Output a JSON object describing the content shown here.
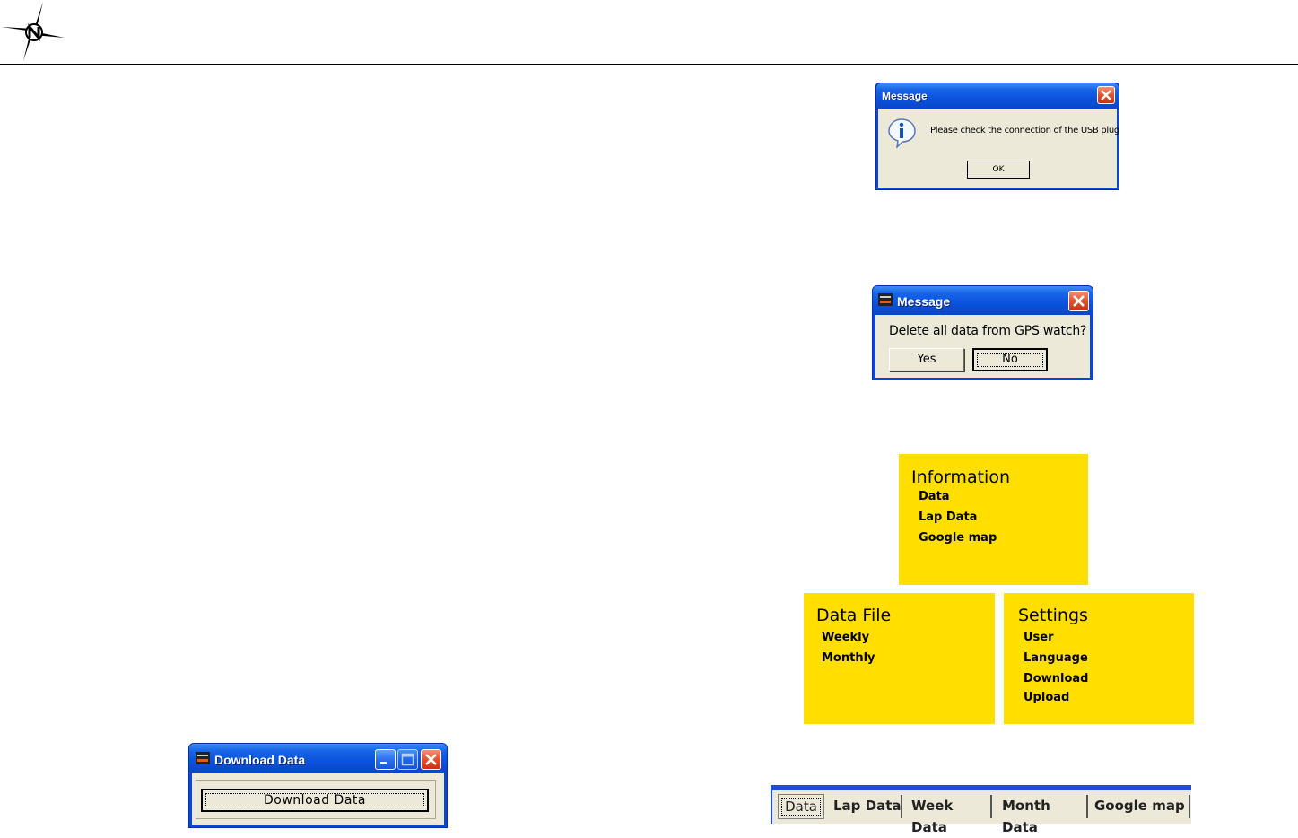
{
  "dialog_usb": {
    "title": "Message",
    "message": "Please check the connection of the USB plug",
    "ok_label": "OK"
  },
  "dialog_delete": {
    "title": "Message",
    "message": "Delete all data from GPS watch?",
    "yes_label": "Yes",
    "no_label": "No"
  },
  "menu_information": {
    "heading": "Information",
    "items": [
      "Data",
      "Lap Data",
      "Google map"
    ]
  },
  "menu_data_file": {
    "heading": "Data File",
    "items": [
      "Weekly",
      "Monthly"
    ]
  },
  "menu_settings": {
    "heading": "Settings",
    "items": [
      "User",
      "Language",
      "Download",
      "Upload"
    ]
  },
  "download_window": {
    "title": "Download Data",
    "button_label": "Download Data"
  },
  "tabs": [
    "Data",
    "Lap Data",
    "Week Data",
    "Month Data",
    "Google map"
  ],
  "colors": {
    "xp_blue": "#0a46d8",
    "dialog_bg": "#ece9d8",
    "close_red": "#e2512c",
    "menu_yellow": "#ffde00"
  },
  "icons": [
    "compass-logo",
    "info-icon",
    "close-icon",
    "minimize-icon",
    "maximize-icon",
    "app-icon"
  ]
}
